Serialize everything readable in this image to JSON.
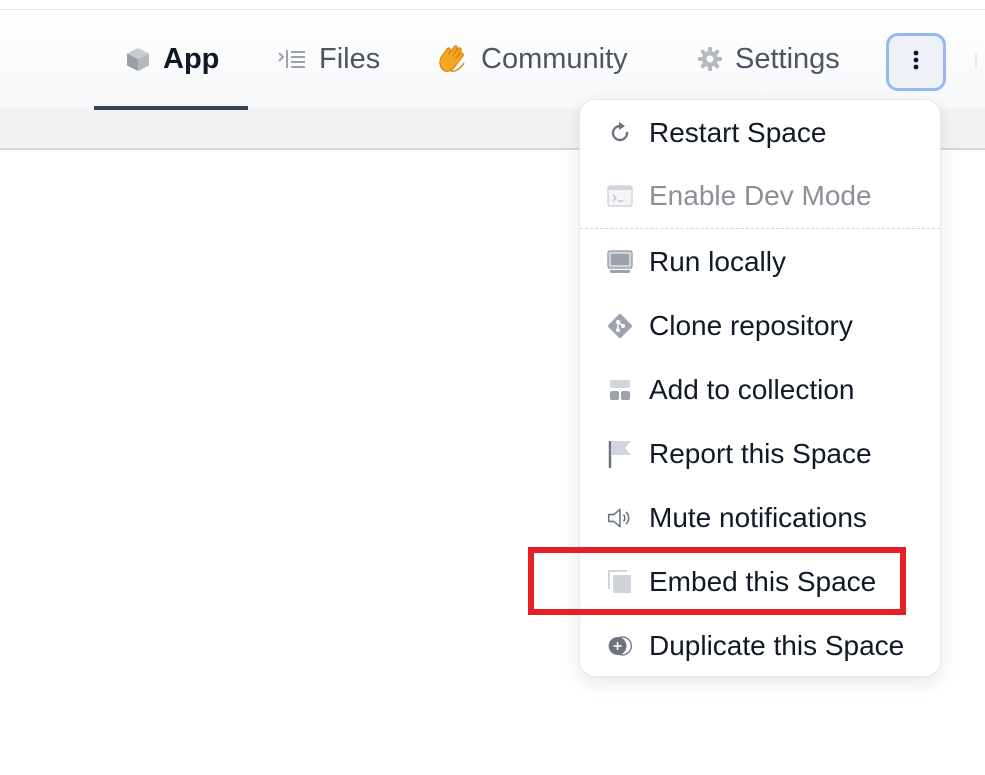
{
  "tabs": [
    {
      "label": "App",
      "icon": "cube-icon",
      "active": true
    },
    {
      "label": "Files",
      "icon": "files-icon",
      "active": false
    },
    {
      "label": "Community",
      "icon": "clapping-hands-icon",
      "active": false
    },
    {
      "label": "Settings",
      "icon": "gear-icon",
      "active": false
    }
  ],
  "more_button": {
    "icon": "vertical-dots-icon"
  },
  "menu": {
    "items": [
      {
        "label": "Restart Space",
        "icon": "restart-icon",
        "disabled": false
      },
      {
        "label": "Enable Dev Mode",
        "icon": "terminal-icon",
        "disabled": true
      },
      {
        "label": "Run locally",
        "icon": "monitor-icon",
        "disabled": false
      },
      {
        "label": "Clone repository",
        "icon": "git-icon",
        "disabled": false
      },
      {
        "label": "Add to collection",
        "icon": "collection-icon",
        "disabled": false
      },
      {
        "label": "Report this Space",
        "icon": "flag-icon",
        "disabled": false
      },
      {
        "label": "Mute notifications",
        "icon": "speaker-icon",
        "disabled": false
      },
      {
        "label": "Embed this Space",
        "icon": "embed-icon",
        "disabled": false,
        "highlighted": true
      },
      {
        "label": "Duplicate this Space",
        "icon": "duplicate-icon",
        "disabled": false
      }
    ]
  },
  "colors": {
    "highlight": "#e61f27",
    "focus_ring": "#93b8f5",
    "active_underline": "#374151",
    "community_icon": "#f5a623"
  }
}
